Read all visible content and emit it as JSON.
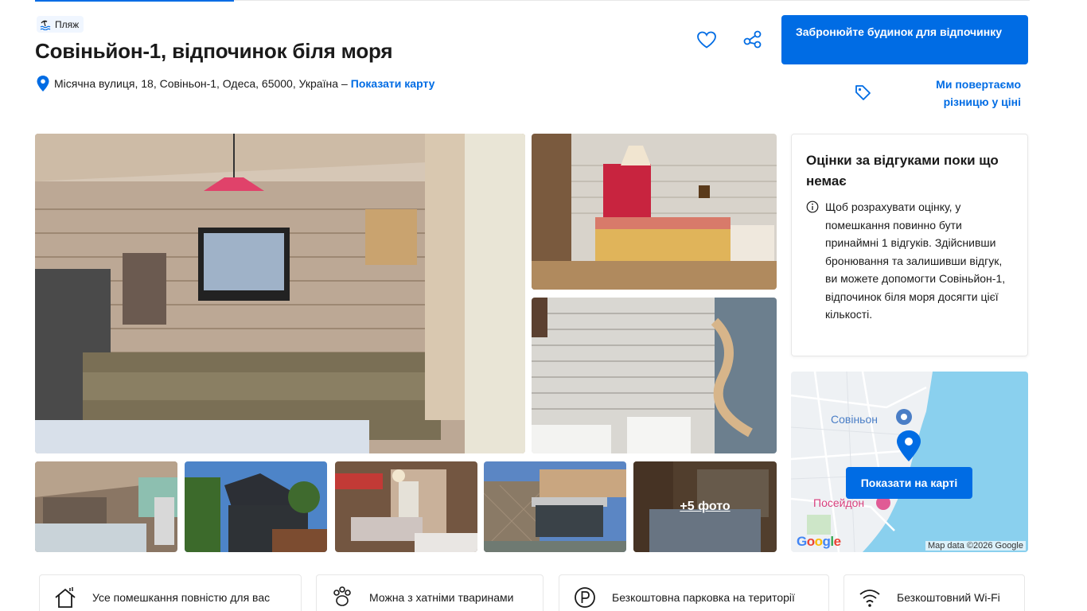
{
  "property": {
    "badge": "Пляж",
    "title": "Совіньйон-1, відпочинок біля моря",
    "address": "Місячна вулиця, 18, Совіньон-1, Одеса, 65000, Україна",
    "address_separator": "–",
    "show_map_link": "Показати карту"
  },
  "actions": {
    "book_button": "Забронюйте будинок для відпочинку",
    "price_match": "Ми повертаємо різницю у ціні",
    "save_icon": "heart-icon",
    "share_icon": "share-icon"
  },
  "gallery": {
    "more_photos": "+5 фото"
  },
  "reviews": {
    "title": "Оцінки за відгуками поки що немає",
    "text": "Щоб розрахувати оцінку, у помешкання повинно бути принаймні 1 відгуків. Здійснивши бронювання та залишивши відгук, ви можете допомогти Совіньйон-1, відпочинок біля моря досягти цієї кількості."
  },
  "map": {
    "button": "Показати на карті",
    "label_sovinyon": "Совіньон",
    "label_poseidon": "Посейдон",
    "google": "Google",
    "copyright": "Map data ©2026 Google"
  },
  "facilities": [
    {
      "label": "Усе помешкання повністю для вас",
      "icon": "house-icon"
    },
    {
      "label": "Можна з хатніми тваринами",
      "icon": "paw-icon"
    },
    {
      "label": "Безкоштовна парковка на території",
      "icon": "parking-icon"
    },
    {
      "label": "Безкоштовний Wi-Fi",
      "icon": "wifi-icon"
    }
  ],
  "colors": {
    "accent": "#006ce4",
    "text": "#1a1a1a",
    "border": "#e7e7e7"
  }
}
